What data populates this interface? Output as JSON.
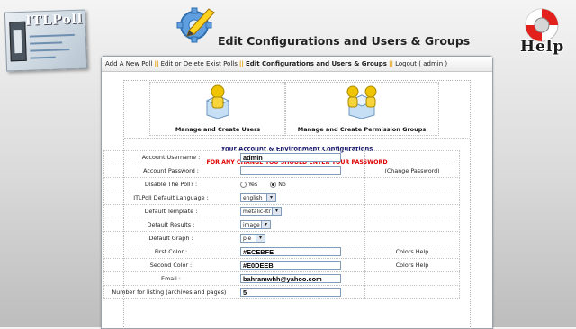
{
  "app": {
    "logo_text": "ITLPoll",
    "page_title": "Edit Configurations and Users & Groups",
    "help_label": "Help"
  },
  "nav": {
    "items": [
      {
        "label": "Add A New Poll"
      },
      {
        "label": "Edit or Delete Exist Polls"
      },
      {
        "label": "Edit Configurations and Users & Groups"
      },
      {
        "label": "Logout ( admin )"
      }
    ],
    "separator": "||"
  },
  "tiles": {
    "users": "Manage and Create Users",
    "groups": "Manage and Create Permission Groups"
  },
  "config": {
    "title": "Your Account & Environment Configurations",
    "warning": "FOR ANY CHANGE YOU SHOULD ENTER YOUR PASSWORD"
  },
  "form": {
    "username_label": "Account Username :",
    "username_value": "admin",
    "password_label": "Account Password :",
    "password_value": "",
    "change_password": "(Change Password)",
    "disable_label": "Disable The Poll? :",
    "disable_yes": "Yes",
    "disable_no": "No",
    "disable_selected": "No",
    "language_label": "ITLPoll Default Language :",
    "language_value": "english",
    "template_label": "Default Template :",
    "template_value": "metalic-ltr",
    "results_label": "Default Results :",
    "results_value": "image",
    "graph_label": "Default Graph :",
    "graph_value": "pie",
    "first_color_label": "First Color :",
    "first_color_value": "#ECEBFE",
    "second_color_label": "Second Color :",
    "second_color_value": "#E0DEEB",
    "colors_help": "Colors Help",
    "email_label": "Email :",
    "email_value": "bahramwhh@yahoo.com",
    "listing_label": "Number for listing (archives and pages) :",
    "listing_value": "5"
  },
  "colors": {
    "warning": "#e00000",
    "title": "#1a1a6e",
    "separator": "#e0a000"
  }
}
